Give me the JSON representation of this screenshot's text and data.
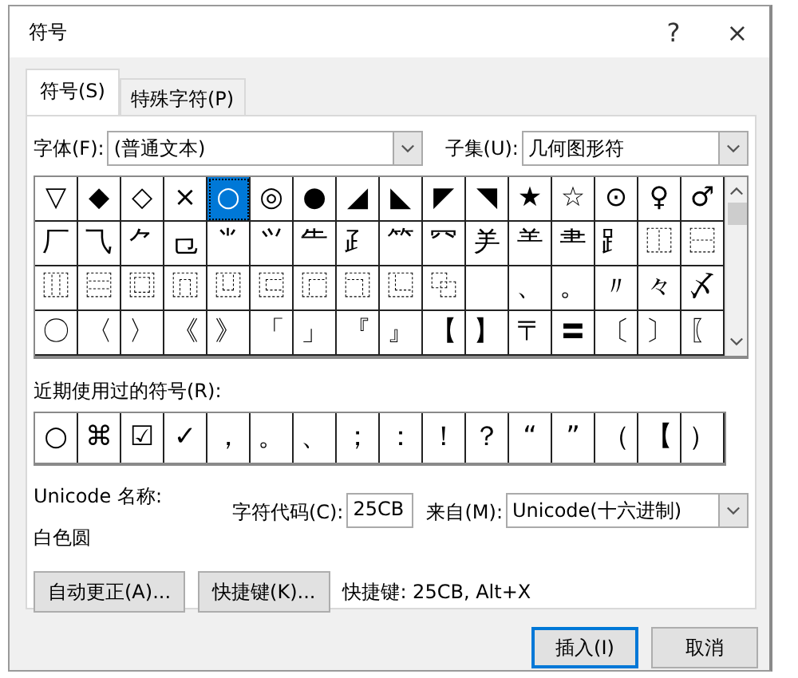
{
  "window": {
    "title": "符号",
    "help_button": "?",
    "close_button": "×"
  },
  "tabs": [
    {
      "label": "符号(S)",
      "selected": true
    },
    {
      "label": "特殊字符(P)",
      "selected": false
    }
  ],
  "font": {
    "label": "字体(F):",
    "value": "(普通文本)"
  },
  "subset": {
    "label": "子集(U):",
    "value": "几何图形符"
  },
  "symbol_grid": [
    [
      {
        "char": "▽",
        "selected": false
      },
      {
        "char": "◆",
        "selected": false
      },
      {
        "char": "◇",
        "selected": false
      },
      {
        "char": "×",
        "selected": false
      },
      {
        "char": "○",
        "selected": true
      },
      {
        "char": "◎",
        "selected": false
      },
      {
        "char": "●",
        "selected": false
      },
      {
        "char": "◢",
        "selected": false
      },
      {
        "char": "◣",
        "selected": false
      },
      {
        "char": "◤",
        "selected": false
      },
      {
        "char": "◥",
        "selected": false
      },
      {
        "char": "★",
        "selected": false
      },
      {
        "char": "☆",
        "selected": false
      },
      {
        "char": "⊙",
        "selected": false
      },
      {
        "char": "♀",
        "selected": false
      },
      {
        "char": "♂",
        "selected": false
      }
    ],
    [
      {
        "char": "厂",
        "selected": false
      },
      {
        "char": "⺄",
        "selected": false
      },
      {
        "char": "⺈",
        "selected": false
      },
      {
        "char": "⺋",
        "selected": false
      },
      {
        "char": "⺌",
        "selected": false
      },
      {
        "char": "⺍",
        "selected": false
      },
      {
        "char": "⺧",
        "selected": false
      },
      {
        "char": "⺪",
        "selected": false
      },
      {
        "char": "⺮",
        "selected": false
      },
      {
        "char": "⺳",
        "selected": false
      },
      {
        "char": "⺶",
        "selected": false
      },
      {
        "char": "⺷",
        "selected": false
      },
      {
        "char": "⺻",
        "selected": false
      },
      {
        "char": "⻊",
        "selected": false
      },
      {
        "char": "⿰",
        "selected": false
      },
      {
        "char": "⿱",
        "selected": false
      }
    ],
    [
      {
        "char": "⿲",
        "selected": false
      },
      {
        "char": "⿳",
        "selected": false
      },
      {
        "char": "⿴",
        "selected": false
      },
      {
        "char": "⿵",
        "selected": false
      },
      {
        "char": "⿶",
        "selected": false
      },
      {
        "char": "⿷",
        "selected": false
      },
      {
        "char": "⿸",
        "selected": false
      },
      {
        "char": "⿹",
        "selected": false
      },
      {
        "char": "⿺",
        "selected": false
      },
      {
        "char": "⿻",
        "selected": false
      },
      {
        "selected": false
      },
      {
        "char": "、",
        "selected": false
      },
      {
        "char": "。",
        "selected": false
      },
      {
        "char": "〃",
        "selected": false
      },
      {
        "char": "々",
        "selected": false
      },
      {
        "char": "〆",
        "selected": false
      }
    ],
    [
      {
        "char": "〇",
        "selected": false
      },
      {
        "char": "〈",
        "selected": false
      },
      {
        "char": "〉",
        "selected": false
      },
      {
        "char": "《",
        "selected": false
      },
      {
        "char": "》",
        "selected": false
      },
      {
        "char": "「",
        "selected": false
      },
      {
        "char": "」",
        "selected": false
      },
      {
        "char": "『",
        "selected": false
      },
      {
        "char": "』",
        "selected": false
      },
      {
        "char": "【",
        "selected": false
      },
      {
        "char": "】",
        "selected": false
      },
      {
        "char": "〒",
        "selected": false
      },
      {
        "char": "〓",
        "selected": false
      },
      {
        "char": "〔",
        "selected": false
      },
      {
        "char": "〕",
        "selected": false
      },
      {
        "char": "〖",
        "selected": false
      }
    ]
  ],
  "recent": {
    "label": "近期使用过的符号(R):",
    "symbols": [
      "○",
      "⌘",
      "☑",
      "✓",
      "，",
      "。",
      "、",
      "；",
      "：",
      "！",
      "？",
      "“",
      "”",
      "（",
      "【",
      "）"
    ]
  },
  "unicode_name": {
    "label": "Unicode 名称:",
    "value": "白色圆"
  },
  "char_code": {
    "label": "字符代码(C):",
    "value": "25CB"
  },
  "from": {
    "label": "来自(M):",
    "value": "Unicode(十六进制)"
  },
  "buttons": [
    "自动更正(A)...",
    "快捷键(K)..."
  ],
  "shortcut_text": "快捷键: 25CB, Alt+X",
  "footer_buttons": [
    {
      "label": "插入(I)",
      "default": true
    },
    {
      "label": "取消",
      "default": false
    }
  ]
}
